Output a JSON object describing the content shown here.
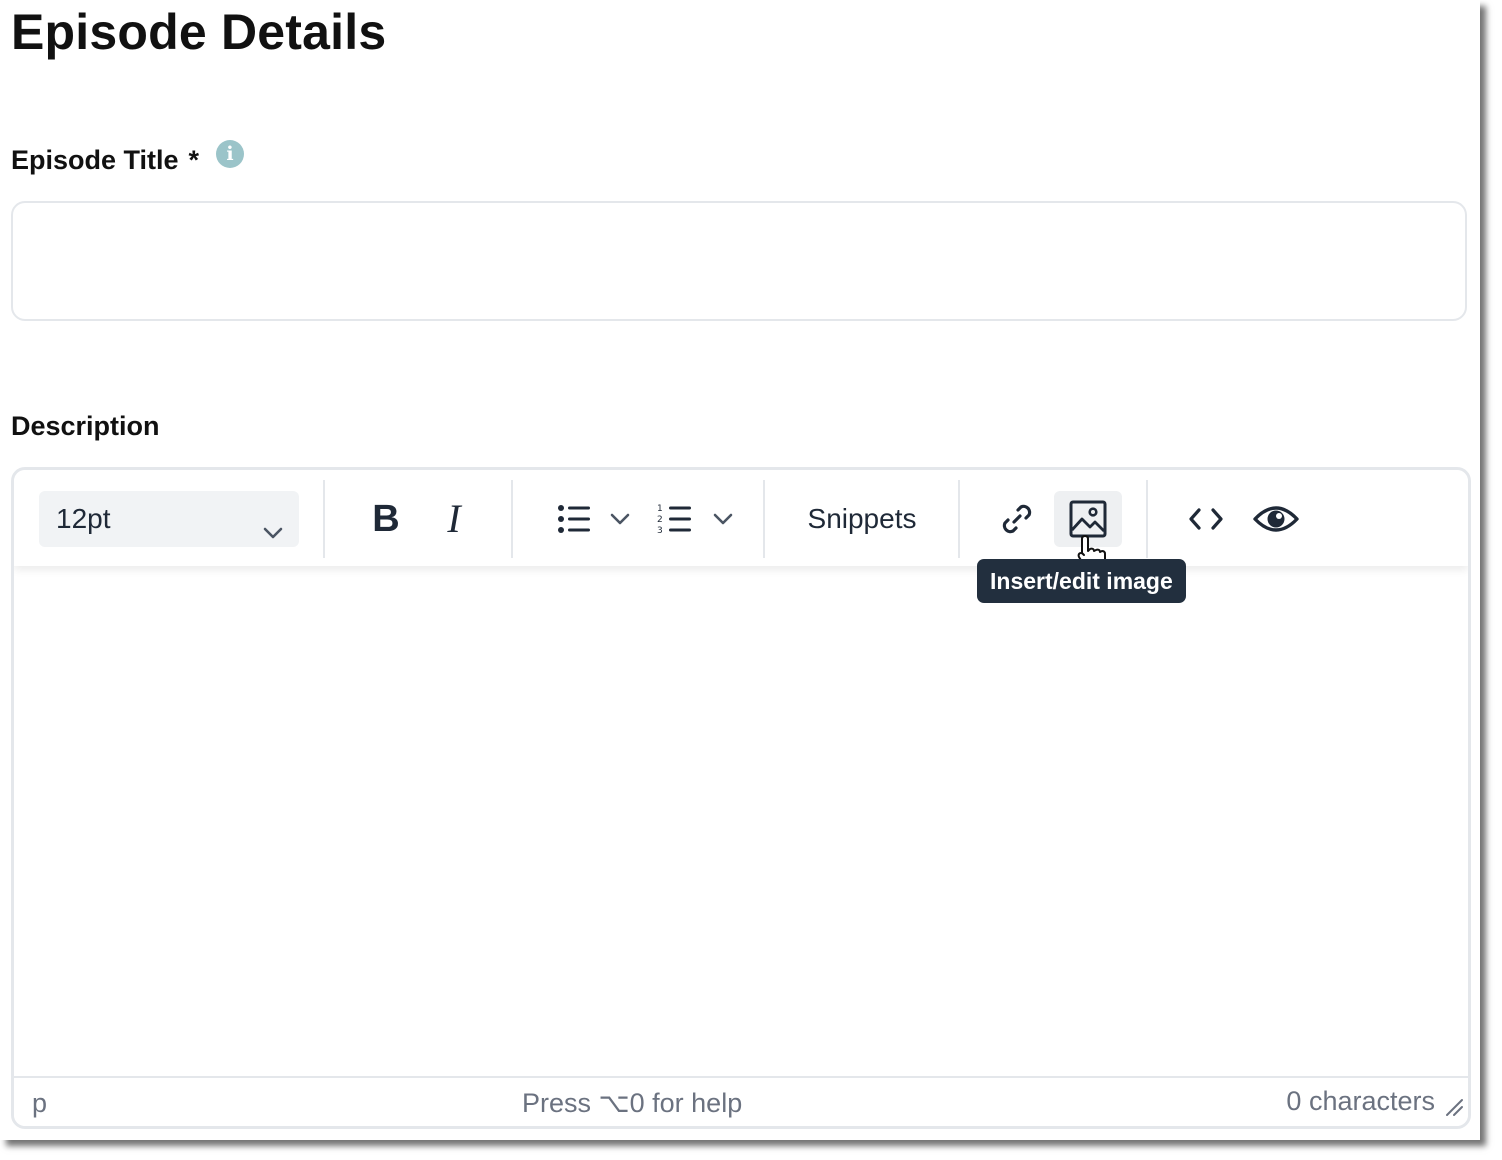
{
  "page": {
    "title": "Episode Details"
  },
  "episode_title": {
    "label": "Episode Title",
    "required_marker": "*",
    "info_icon": "info-icon",
    "value": "",
    "placeholder": ""
  },
  "description": {
    "label": "Description",
    "toolbar": {
      "font_size": "12pt",
      "bold_label": "B",
      "italic_label": "I",
      "bullet_list_icon": "bullet-list-icon",
      "numbered_list_icon": "numbered-list-icon",
      "snippets_label": "Snippets",
      "link_icon": "link-icon",
      "image_icon": "image-icon",
      "code_icon": "code-icon",
      "preview_icon": "eye-icon",
      "tooltip": "Insert/edit image"
    },
    "statusbar": {
      "path": "p",
      "help": "Press ⌥0 for help",
      "char_count": "0 characters"
    }
  },
  "colors": {
    "info_icon": "#9bc4c9",
    "tooltip_bg": "#222f3e",
    "border": "#e4e7eb",
    "select_bg": "#f1f3f5"
  }
}
